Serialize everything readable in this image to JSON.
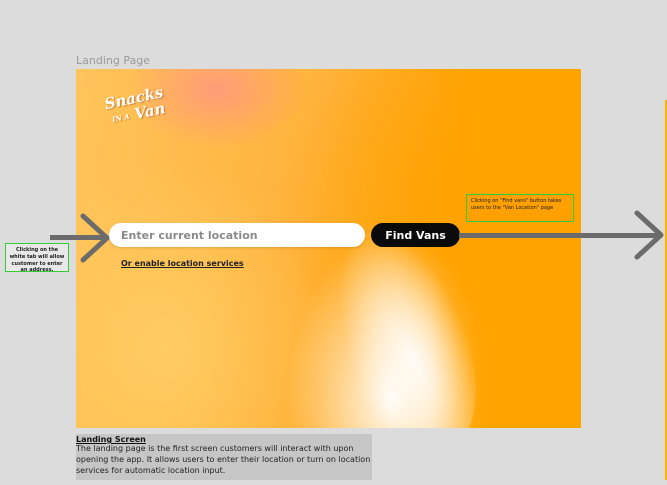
{
  "frame": {
    "label": "Landing Page"
  },
  "logo": {
    "line1": "Snacks",
    "line2": "IN A",
    "line3": "Van"
  },
  "search": {
    "placeholder": "Enter current location",
    "button_label": "Find Vans",
    "enable_location_link": "Or enable location services"
  },
  "annotations": {
    "left_note": "Clicking on the white tab will allow customer to enter an address.",
    "right_note": "Clicking on \"Find vans\" button takes users to the \"Van Location\" page"
  },
  "caption": {
    "title": "Landing Screen",
    "body": "The landing page is the first screen customers will interact with upon opening the app. It allows users to enter their location or turn on location services for automatic location input."
  },
  "colors": {
    "accent_orange": "#ffa000",
    "button_black": "#0a0a0a",
    "annotation_border": "#33cc33",
    "arrow_gray": "#6b6b6b",
    "page_background": "#dcdcdc"
  },
  "icons": {
    "left_arrow": "arrow-right-icon",
    "right_arrow": "arrow-right-icon"
  }
}
